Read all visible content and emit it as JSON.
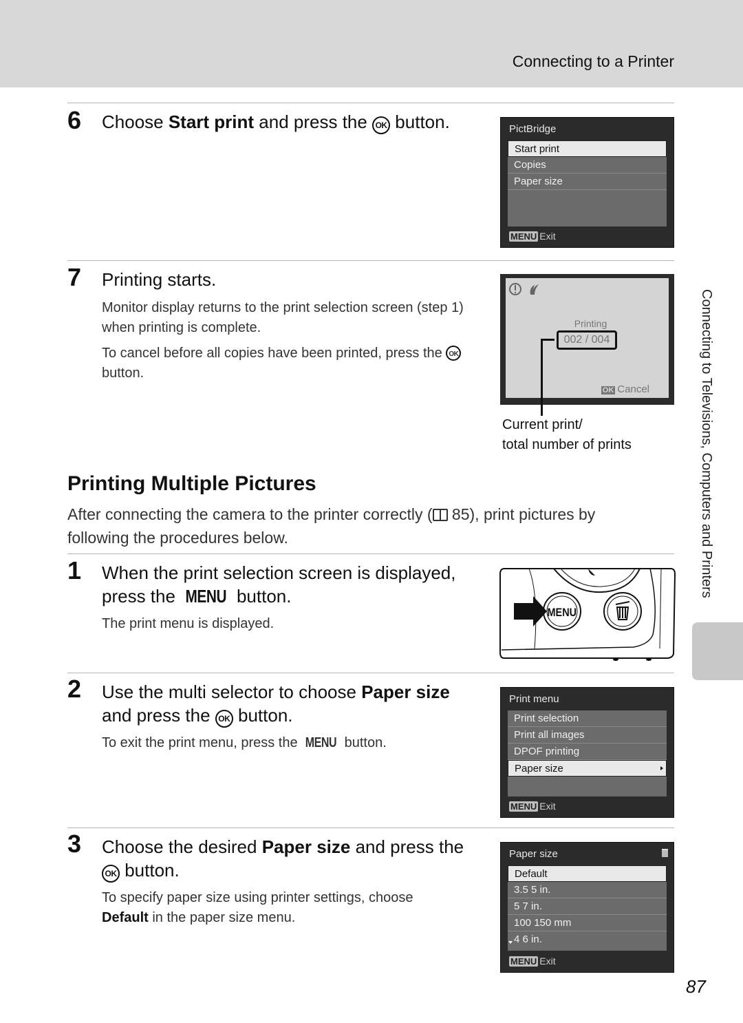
{
  "header": {
    "section_title": "Connecting to a Printer"
  },
  "side_label": "Connecting to Televisions, Computers and Printers",
  "page_number": "87",
  "steps_top": [
    {
      "number": "6",
      "heading_pre": "Choose ",
      "heading_bold": "Start print",
      "heading_post": " and press the ",
      "heading_icon": "OK",
      "heading_end": " button."
    },
    {
      "number": "7",
      "heading": "Printing starts.",
      "para1": "Monitor display returns to the print selection screen (step 1) when printing is complete.",
      "para2_pre": "To cancel before all copies have been printed, press the ",
      "para2_icon": "OK",
      "para2_end": " button."
    }
  ],
  "pictbridge_screen": {
    "title": "PictBridge",
    "items": [
      "Start print",
      "Copies",
      "Paper size"
    ],
    "selected": "Start print",
    "footer_key": "MENU",
    "footer_label": "Exit"
  },
  "printing_screen": {
    "status": "Printing",
    "counter": "002 / 004",
    "footer_key": "OK",
    "footer_label": "Cancel",
    "callout_line1": "Current print/",
    "callout_line2": "total number of prints"
  },
  "section": {
    "title": "Printing Multiple Pictures",
    "intro_pre": "After connecting the camera to the printer correctly (",
    "intro_ref": "85",
    "intro_post": "), print pictures by following the procedures below."
  },
  "steps_multi": [
    {
      "number": "1",
      "heading_pre": "When the print selection screen is displayed, press the ",
      "heading_icon": "MENU",
      "heading_end": " button.",
      "note": "The print menu is displayed."
    },
    {
      "number": "2",
      "heading_pre": "Use the multi selector to choose ",
      "heading_bold": "Paper size",
      "heading_mid": " and press the ",
      "heading_icon": "OK",
      "heading_end": " button.",
      "note_pre": "To exit the print menu, press the ",
      "note_icon": "MENU",
      "note_end": " button."
    },
    {
      "number": "3",
      "heading_pre": "Choose the desired ",
      "heading_bold": "Paper size",
      "heading_mid": " and press the ",
      "heading_icon": "OK",
      "heading_end": " button.",
      "note_pre": "To specify paper size using printer settings, choose ",
      "note_bold": "Default",
      "note_end": " in the paper size menu."
    }
  ],
  "camera_illustration": {
    "button_label": "MENU"
  },
  "print_menu_screen": {
    "title": "Print menu",
    "items": [
      "Print selection",
      "Print all images",
      "DPOF printing",
      "Paper size"
    ],
    "selected": "Paper size",
    "footer_key": "MENU",
    "footer_label": "Exit"
  },
  "paper_size_screen": {
    "title": "Paper size",
    "items": [
      "Default",
      "3.5 5 in.",
      "5 7 in.",
      "100 150 mm",
      "4 6 in."
    ],
    "selected": "Default",
    "footer_key": "MENU",
    "footer_label": "Exit"
  }
}
